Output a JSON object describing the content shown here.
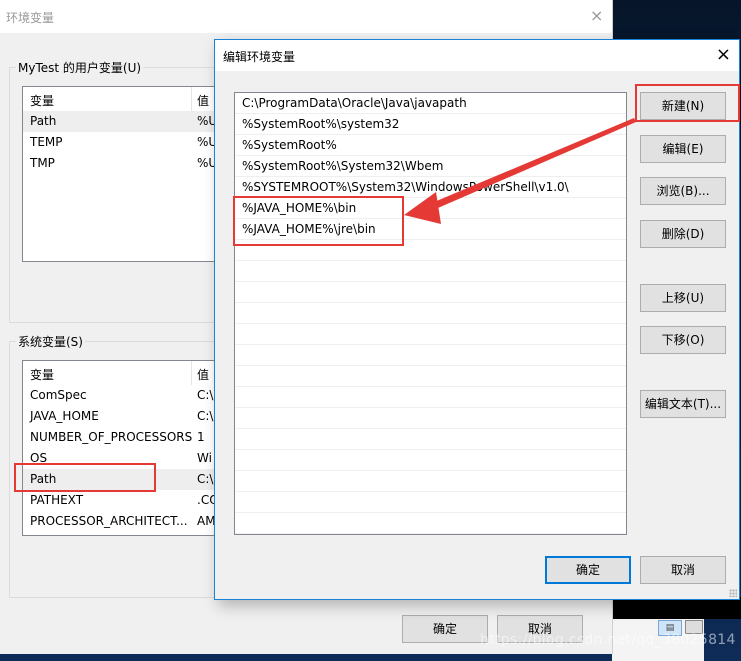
{
  "outer_window": {
    "title": "环境变量",
    "close_icon": "×",
    "user_vars": {
      "group_label": "MyTest 的用户变量(U)",
      "columns": [
        "变量",
        "值"
      ],
      "rows": [
        {
          "name": "Path",
          "value": "%U",
          "selected": true
        },
        {
          "name": "TEMP",
          "value": "%U"
        },
        {
          "name": "TMP",
          "value": "%U"
        }
      ]
    },
    "system_vars": {
      "group_label": "系统变量(S)",
      "columns": [
        "变量",
        "值"
      ],
      "rows": [
        {
          "name": "ComSpec",
          "value": "C:\\"
        },
        {
          "name": "JAVA_HOME",
          "value": "C:\\"
        },
        {
          "name": "NUMBER_OF_PROCESSORS",
          "value": "1"
        },
        {
          "name": "OS",
          "value": "Wi"
        },
        {
          "name": "Path",
          "value": "C:\\",
          "selected": true
        },
        {
          "name": "PATHEXT",
          "value": ".CO"
        },
        {
          "name": "PROCESSOR_ARCHITECT...",
          "value": "AM"
        }
      ]
    },
    "ok_label": "确定",
    "cancel_label": "取消"
  },
  "edit_dialog": {
    "title": "编辑环境变量",
    "close_icon": "×",
    "paths": [
      "C:\\ProgramData\\Oracle\\Java\\javapath",
      "%SystemRoot%\\system32",
      "%SystemRoot%",
      "%SystemRoot%\\System32\\Wbem",
      "%SYSTEMROOT%\\System32\\WindowsPowerShell\\v1.0\\",
      "%JAVA_HOME%\\bin",
      "%JAVA_HOME%\\jre\\bin"
    ],
    "buttons": {
      "new": "新建(N)",
      "edit": "编辑(E)",
      "browse": "浏览(B)...",
      "delete": "删除(D)",
      "move_up": "上移(U)",
      "move_down": "下移(O)",
      "edit_text": "编辑文本(T)..."
    },
    "ok_label": "确定",
    "cancel_label": "取消"
  },
  "annotations": {
    "highlight_color": "#e53935",
    "arrow_from": "新建(N)",
    "arrow_to": "%JAVA_HOME% entries"
  },
  "taskbar": {
    "thumb_icon": "▤"
  },
  "watermark": "https://blog.csdn.net/qq_38025814"
}
